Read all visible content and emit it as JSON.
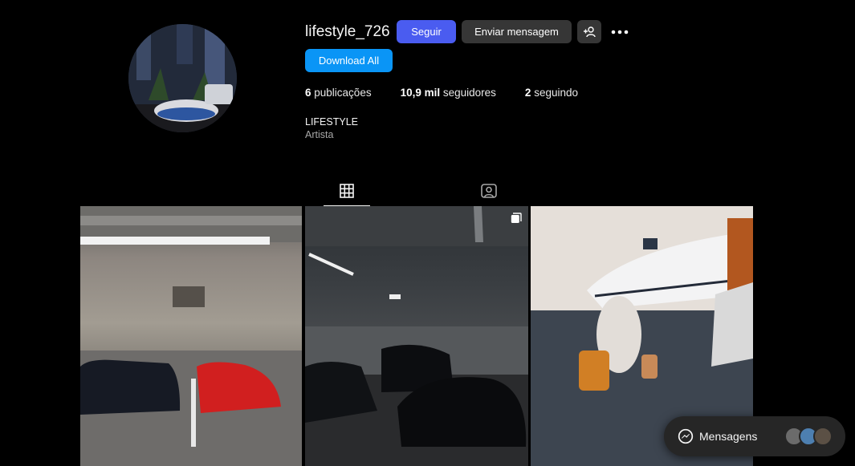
{
  "profile": {
    "username": "lifestyle_726",
    "follow_label": "Seguir",
    "message_label": "Enviar mensagem",
    "download_label": "Download All",
    "stats": {
      "posts_count": "6",
      "posts_label": "publicações",
      "followers_count": "10,9 mil",
      "followers_label": "seguidores",
      "following_count": "2",
      "following_label": "seguindo"
    },
    "bio_name": "LIFESTYLE",
    "bio_category": "Artista"
  },
  "tabs": [
    {
      "icon": "grid-icon",
      "active": true
    },
    {
      "icon": "tagged-icon",
      "active": false
    }
  ],
  "posts": [
    {
      "description_icon": "image",
      "multi": false
    },
    {
      "description_icon": "image",
      "multi": true
    },
    {
      "description_icon": "image",
      "multi": false
    }
  ],
  "messenger": {
    "label": "Mensagens"
  },
  "colors": {
    "follow": "#4a5cf0",
    "download": "#0a95f6",
    "secondary_button": "#363636",
    "background": "#000000"
  }
}
